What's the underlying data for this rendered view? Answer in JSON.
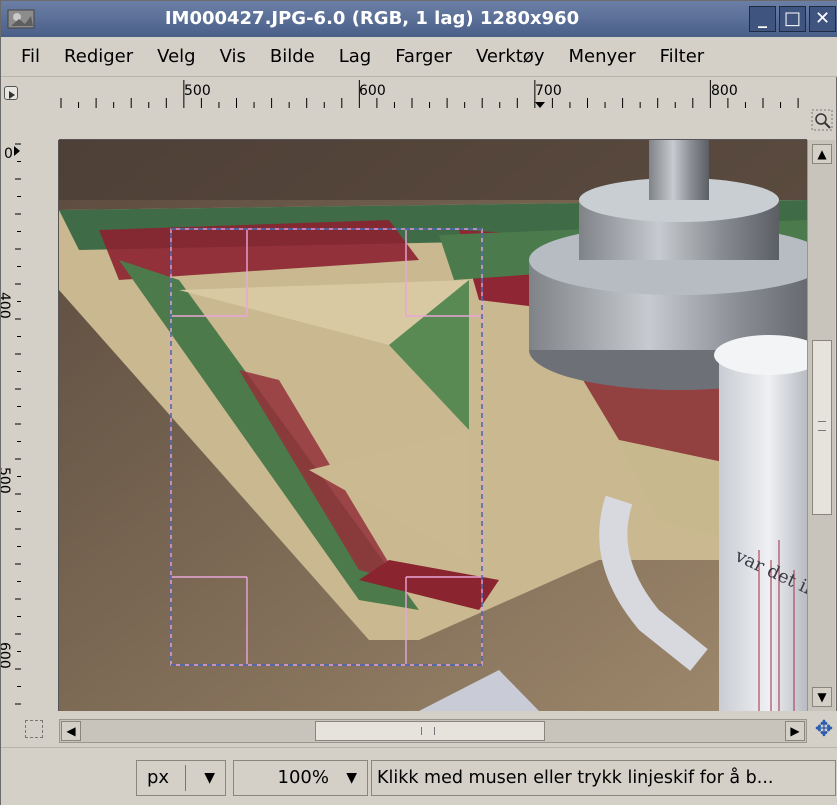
{
  "window": {
    "title": "IM000427.JPG-6.0 (RGB, 1 lag) 1280x960",
    "min_glyph": "_",
    "max_glyph": "□",
    "close_glyph": "✕"
  },
  "menu": [
    {
      "label": "Fil"
    },
    {
      "label": "Rediger"
    },
    {
      "label": "Velg"
    },
    {
      "label": "Vis"
    },
    {
      "label": "Bilde"
    },
    {
      "label": "Lag"
    },
    {
      "label": "Farger"
    },
    {
      "label": "Verktøy"
    },
    {
      "label": "Menyer"
    },
    {
      "label": "Filter"
    }
  ],
  "rulers": {
    "horizontal_labels": [
      "500",
      "600",
      "700",
      "800"
    ],
    "vertical_labels": [
      "0",
      "400",
      "500",
      "600"
    ]
  },
  "canvas": {
    "cup_text": "var det il"
  },
  "statusbar": {
    "unit": "px",
    "zoom": "100%",
    "message": "Klikk med musen eller trykk linjeskif for å b..."
  },
  "icons": {
    "app": "gimp-wilber-icon",
    "navigate": "navigate-icon",
    "zoom_toggle": "zoom-fit-icon",
    "quick_mask": "quick-mask-icon",
    "menu_toggle": "menu-triangle-icon"
  },
  "colors": {
    "titlebar": "#4a5f88",
    "guide": "#e9a6d8",
    "selection_dashes": "#3b5fae"
  }
}
